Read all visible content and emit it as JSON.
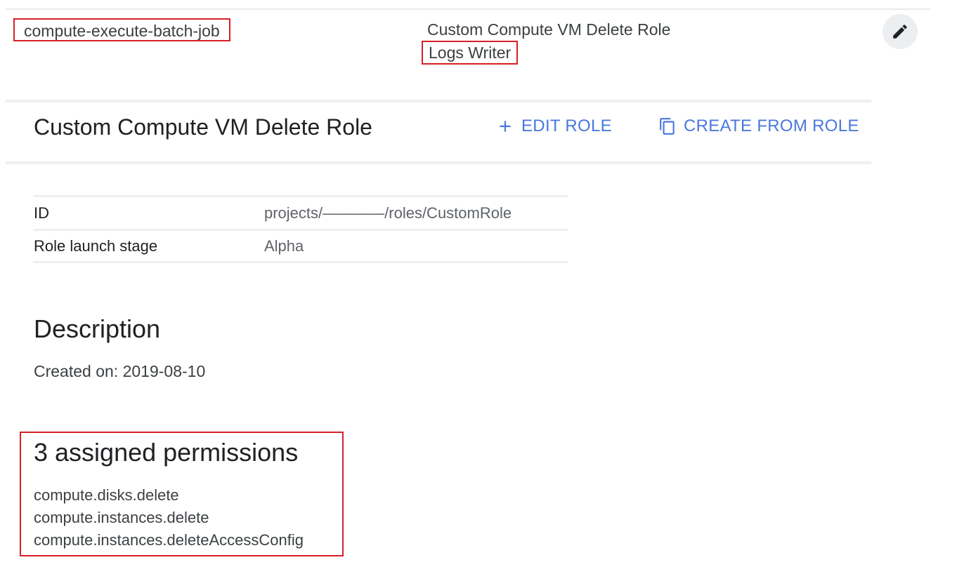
{
  "member": {
    "name": "compute-execute-batch-job",
    "roles": [
      "Custom Compute VM Delete Role",
      "Logs Writer"
    ]
  },
  "role": {
    "title": "Custom Compute VM Delete Role",
    "edit_label": "EDIT ROLE",
    "create_label": "CREATE FROM ROLE"
  },
  "details": {
    "rows": [
      {
        "label": "ID",
        "value": "projects/————/roles/CustomRole"
      },
      {
        "label": "Role launch stage",
        "value": "Alpha"
      }
    ]
  },
  "description": {
    "heading": "Description",
    "text": "Created on: 2019-08-10"
  },
  "permissions": {
    "heading": "3 assigned permissions",
    "items": [
      "compute.disks.delete",
      "compute.instances.delete",
      "compute.instances.deleteAccessConfig"
    ]
  },
  "colors": {
    "accent": "#4a78dc",
    "highlight_border": "#d61f26"
  }
}
